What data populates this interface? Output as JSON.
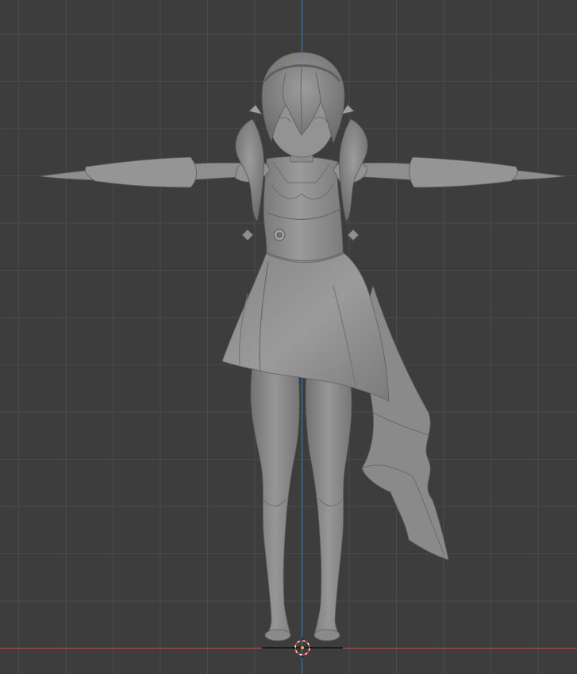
{
  "viewport": {
    "view_mode": "front-orthographic",
    "shading": "solid",
    "background_color": "#3d3d3d",
    "grid_color": "#4a4a4a",
    "x_axis_color": "#a8474b",
    "z_axis_color": "#3a6fb3",
    "model_color": "#8d8d8d",
    "object": "character-mesh"
  }
}
